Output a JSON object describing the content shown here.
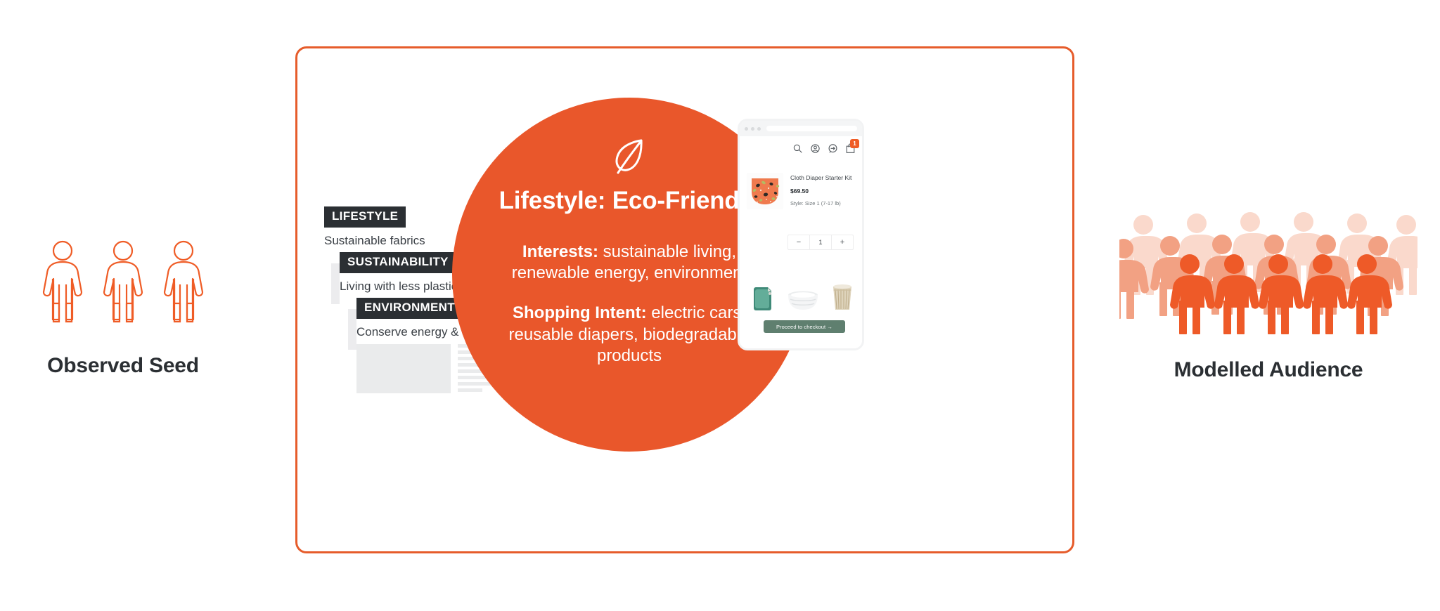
{
  "theme": {
    "orange": "#e9572b",
    "orange_border": "#e65c2b",
    "dark": "#2b2f33",
    "crowd_back": "#fad9cc",
    "crowd_mid": "#f2a183",
    "crowd_front": "#ee5a28",
    "checkout_green": "#5f7f6f"
  },
  "left": {
    "label": "Observed Seed",
    "figure_count": 3,
    "figure_icon": "person-outline-icon"
  },
  "right": {
    "label": "Modelled Audience",
    "rows": [
      {
        "tone": "back",
        "count": 6
      },
      {
        "tone": "mid",
        "count": 6
      },
      {
        "tone": "front",
        "count": 5
      }
    ],
    "figure_icon": "person-solid-icon"
  },
  "card": {
    "articles": [
      {
        "headline": "LIFESTYLE",
        "subtitle": "Sustainable fabrics"
      },
      {
        "headline": "SUSTAINABILITY",
        "subtitle": "Living with less plastic"
      },
      {
        "headline": "ENVIRONMENT",
        "subtitle": "Conserve energy & save"
      }
    ],
    "article_body_lines": 8,
    "circle": {
      "icon": "leaf-icon",
      "title": "Lifestyle: Eco-Friendly",
      "interests_label": "Interests:",
      "interests_value": " sustainable living, renewable energy, environment",
      "intent_label": "Shopping Intent:",
      "intent_value": " electric cars, reusable diapers, biodegradable products"
    },
    "phone": {
      "nav_icons": [
        "search-icon",
        "account-icon",
        "chat-icon",
        "shopping-bag-icon"
      ],
      "cart_badge": "1",
      "product": {
        "title": "Cloth Diaper Starter Kit",
        "price": "$69.50",
        "style": "Style: Size 1 (7-17 lb)",
        "image": "cloth-diaper-image"
      },
      "stepper": {
        "decrement": "−",
        "quantity": "1",
        "increment": "+"
      },
      "thumbnails": [
        "teal-pouch-image",
        "white-bowl-image",
        "woven-basket-image"
      ],
      "checkout_label": "Proceed to checkout  →"
    }
  }
}
